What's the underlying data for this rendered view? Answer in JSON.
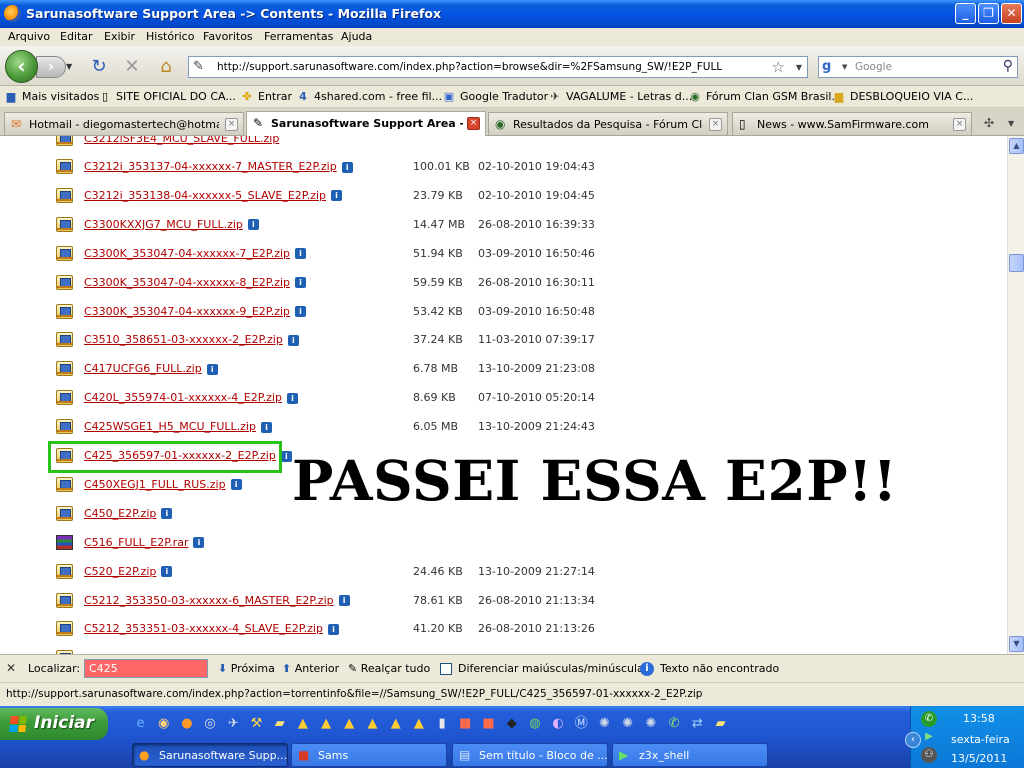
{
  "window": {
    "title": "Sarunasoftware Support Area -> Contents - Mozilla Firefox"
  },
  "menu": [
    "Arquivo",
    "Editar",
    "Exibir",
    "Histórico",
    "Favoritos",
    "Ferramentas",
    "Ajuda"
  ],
  "nav": {
    "url": "http://support.sarunasoftware.com/index.php?action=browse&dir=%2FSamsung_SW/!E2P_FULL",
    "search_placeholder": "Google"
  },
  "bookmarks": [
    "Mais visitados",
    "SITE OFICIAL DO CA...",
    "Entrar",
    "4shared.com - free fil...",
    "Google Tradutor",
    "VAGALUME - Letras d...",
    "Fórum Clan GSM Brasil...",
    "DESBLOQUEIO VIA C..."
  ],
  "tabs": [
    {
      "label": "Hotmail - diegomastertech@hotmail.c...",
      "active": false
    },
    {
      "label": "Sarunasoftware Support Area -...",
      "active": true
    },
    {
      "label": "Resultados da Pesquisa - Fórum Clan ...",
      "active": false
    },
    {
      "label": "News - www.SamFirmware.com",
      "active": false
    }
  ],
  "files": [
    {
      "name": "C3212i_353137-04-xxxxxx-7_MASTER_E2P.zip",
      "size": "100.01 KB",
      "date": "02-10-2010 19:04:43",
      "type": "zip"
    },
    {
      "name": "C3212i_353138-04-xxxxxx-5_SLAVE_E2P.zip",
      "size": "23.79 KB",
      "date": "02-10-2010 19:04:45",
      "type": "zip"
    },
    {
      "name": "C3300KXXJG7_MCU_FULL.zip",
      "size": "14.47 MB",
      "date": "26-08-2010 16:39:33",
      "type": "zip"
    },
    {
      "name": "C3300K_353047-04-xxxxxx-7_E2P.zip",
      "size": "51.94 KB",
      "date": "03-09-2010 16:50:46",
      "type": "zip"
    },
    {
      "name": "C3300K_353047-04-xxxxxx-8_E2P.zip",
      "size": "59.59 KB",
      "date": "26-08-2010 16:30:11",
      "type": "zip"
    },
    {
      "name": "C3300K_353047-04-xxxxxx-9_E2P.zip",
      "size": "53.42 KB",
      "date": "03-09-2010 16:50:48",
      "type": "zip"
    },
    {
      "name": "C3510_358651-03-xxxxxx-2_E2P.zip",
      "size": "37.24 KB",
      "date": "11-03-2010 07:39:17",
      "type": "zip"
    },
    {
      "name": "C417UCFG6_FULL.zip",
      "size": "6.78 MB",
      "date": "13-10-2009 21:23:08",
      "type": "zip"
    },
    {
      "name": "C420L_355974-01-xxxxxx-4_E2P.zip",
      "size": "8.69 KB",
      "date": "07-10-2010 05:20:14",
      "type": "zip"
    },
    {
      "name": "C425WSGE1_H5_MCU_FULL.zip",
      "size": "6.05 MB",
      "date": "13-10-2009 21:24:43",
      "type": "zip"
    },
    {
      "name": "C425_356597-01-xxxxxx-2_E2P.zip",
      "size": "",
      "date": "",
      "type": "zip"
    },
    {
      "name": "C450XEGJ1_FULL_RUS.zip",
      "size": "",
      "date": "",
      "type": "zip"
    },
    {
      "name": "C450_E2P.zip",
      "size": "",
      "date": "",
      "type": "zip"
    },
    {
      "name": "C516_FULL_E2P.rar",
      "size": "",
      "date": "",
      "type": "rar"
    },
    {
      "name": "C520_E2P.zip",
      "size": "24.46 KB",
      "date": "13-10-2009 21:27:14",
      "type": "zip"
    },
    {
      "name": "C5212_353350-03-xxxxxx-6_MASTER_E2P.zip",
      "size": "78.61 KB",
      "date": "26-08-2010 21:13:34",
      "type": "zip"
    },
    {
      "name": "C5212_353351-03-xxxxxx-4_SLAVE_E2P.zip",
      "size": "41.20 KB",
      "date": "26-08-2010 21:13:26",
      "type": "zip"
    }
  ],
  "annotation": "PASSEI ESSA E2P!!",
  "findbar": {
    "label": "Localizar:",
    "value": "C425",
    "next": "Próxima",
    "prev": "Anterior",
    "highlight": "Realçar tudo",
    "match_case": "Diferenciar maiúsculas/minúsculas",
    "status": "Texto não encontrado"
  },
  "status_url": "http://support.sarunasoftware.com/index.php?action=torrentinfo&file=//Samsung_SW/!E2P_FULL/C425_356597-01-xxxxxx-2_E2P.zip",
  "taskbar": {
    "start": "Iniciar",
    "tasks": [
      {
        "label": "Sarunasoftware Supp...",
        "active": true
      },
      {
        "label": "Sams",
        "active": false
      },
      {
        "label": "Sem título - Bloco de ...",
        "active": false
      },
      {
        "label": "z3x_shell",
        "active": false
      }
    ],
    "clock": "13:58",
    "day": "sexta-feira",
    "date": "13/5/2011"
  },
  "colors": {
    "link": "#b00000",
    "highlight_border": "#27c318",
    "find_not_found": "#ff6666"
  }
}
